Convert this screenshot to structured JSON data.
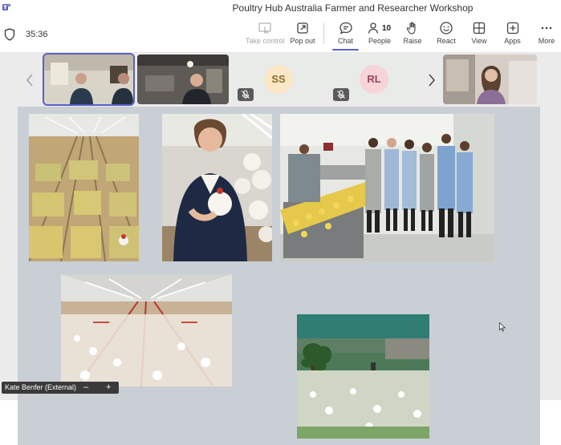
{
  "window": {
    "title": "Poultry Hub Australia Farmer and Researcher Workshop"
  },
  "meeting": {
    "timer": "35:36"
  },
  "toolbar": {
    "take_control": "Take control",
    "pop_out": "Pop out",
    "chat": "Chat",
    "people": "People",
    "people_count": "10",
    "raise": "Raise",
    "react": "React",
    "view": "View",
    "apps": "Apps",
    "more": "More"
  },
  "participants": [
    {
      "kind": "video"
    },
    {
      "kind": "video"
    },
    {
      "kind": "avatar",
      "initials": "SS",
      "muted": true,
      "color": "#fbe7c6"
    },
    {
      "kind": "avatar",
      "initials": "RL",
      "muted": true,
      "color": "#f6d4d8"
    },
    {
      "kind": "video"
    }
  ],
  "presenter": {
    "name": "Kate Benfer (External)"
  },
  "stage_controls": {
    "minus": "–",
    "plus": "+"
  },
  "colors": {
    "accent": "#5b5fc7",
    "share_background": "#c9cfd4"
  }
}
